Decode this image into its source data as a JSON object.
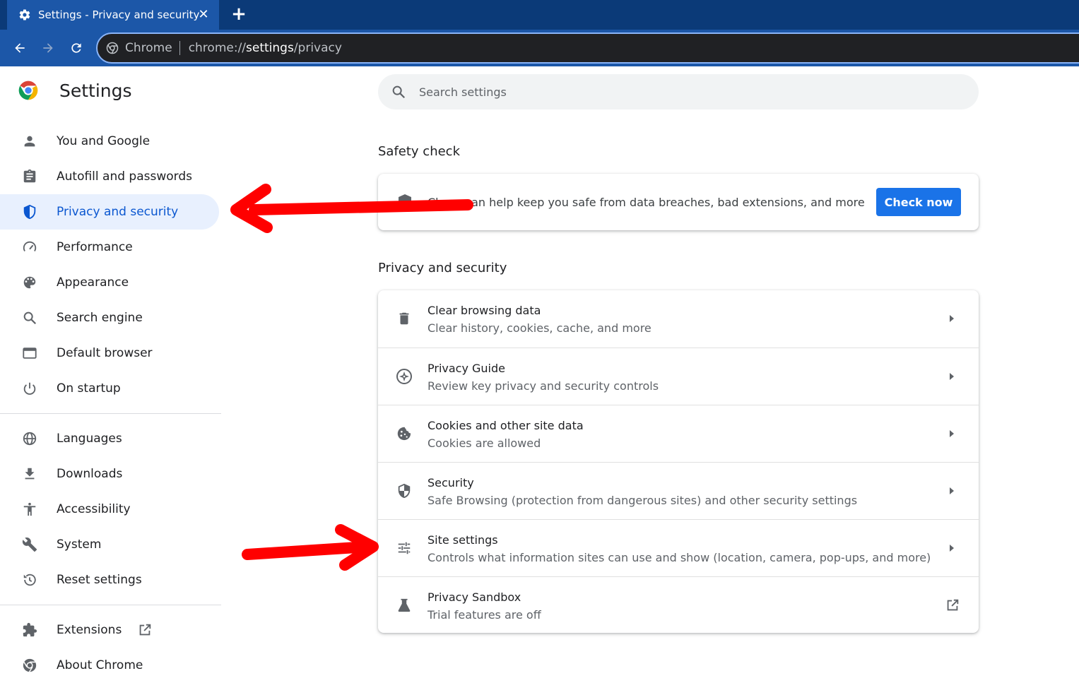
{
  "tab": {
    "title": "Settings - Privacy and security",
    "close": "✕",
    "new_tab": "+"
  },
  "omnibox": {
    "chip": "Chrome",
    "url_prefix": "chrome://",
    "url_host": "settings",
    "url_path": "/privacy"
  },
  "brand": {
    "title": "Settings"
  },
  "search": {
    "placeholder": "Search settings"
  },
  "sidebar": {
    "items": [
      {
        "label": "You and Google",
        "icon": "person-icon"
      },
      {
        "label": "Autofill and passwords",
        "icon": "clipboard-icon"
      },
      {
        "label": "Privacy and security",
        "icon": "shield-icon",
        "active": true
      },
      {
        "label": "Performance",
        "icon": "speedometer-icon"
      },
      {
        "label": "Appearance",
        "icon": "palette-icon"
      },
      {
        "label": "Search engine",
        "icon": "search-icon"
      },
      {
        "label": "Default browser",
        "icon": "browser-window-icon"
      },
      {
        "label": "On startup",
        "icon": "power-icon"
      },
      {
        "label": "Languages",
        "icon": "globe-icon"
      },
      {
        "label": "Downloads",
        "icon": "download-icon"
      },
      {
        "label": "Accessibility",
        "icon": "accessibility-icon"
      },
      {
        "label": "System",
        "icon": "wrench-icon"
      },
      {
        "label": "Reset settings",
        "icon": "history-icon"
      },
      {
        "label": "Extensions",
        "icon": "puzzle-icon"
      },
      {
        "label": "About Chrome",
        "icon": "chrome-icon"
      }
    ]
  },
  "safety_check": {
    "title": "Safety check",
    "visible_prefix": "Ch",
    "description": "can help keep you safe from data breaches, bad extensions, and more",
    "button": "Check now"
  },
  "privacy": {
    "title": "Privacy and security",
    "rows": [
      {
        "title": "Clear browsing data",
        "subtitle": "Clear history, cookies, cache, and more",
        "icon": "trash-icon"
      },
      {
        "title": "Privacy Guide",
        "subtitle": "Review key privacy and security controls",
        "icon": "compass-icon"
      },
      {
        "title": "Cookies and other site data",
        "subtitle": "Cookies are allowed",
        "icon": "cookie-icon"
      },
      {
        "title": "Security",
        "subtitle": "Safe Browsing (protection from dangerous sites) and other security settings",
        "icon": "security-shield-icon"
      },
      {
        "title": "Site settings",
        "subtitle": "Controls what information sites can use and show (location, camera, pop-ups, and more)",
        "icon": "sliders-icon"
      },
      {
        "title": "Privacy Sandbox",
        "subtitle": "Trial features are off",
        "icon": "flask-icon"
      }
    ]
  },
  "colors": {
    "accent": "#1a73e8",
    "active_nav_bg": "#e8f0fe",
    "annotation_red": "#ff0000",
    "tab_strip": "#0b3a78",
    "toolbar": "#1c57a8"
  }
}
